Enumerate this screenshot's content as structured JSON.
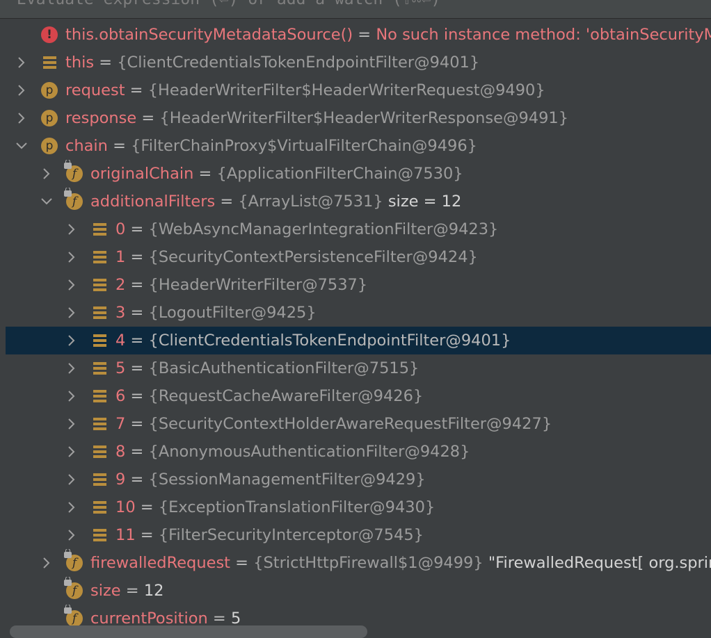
{
  "eval_bar": {
    "placeholder": "Evaluate expression (⏎) or add a watch (⇧⌘⏎)"
  },
  "rows": [
    {
      "name": "this.obtainSecurityMetadataSource()",
      "eq": " = ",
      "error": "No such instance method: 'obtainSecurityMetadataSource'"
    },
    {
      "name": "this",
      "eq": " = ",
      "value": "{ClientCredentialsTokenEndpointFilter@9401}"
    },
    {
      "name": "request",
      "eq": " = ",
      "value": "{HeaderWriterFilter$HeaderWriterRequest@9490}"
    },
    {
      "name": "response",
      "eq": " = ",
      "value": "{HeaderWriterFilter$HeaderWriterResponse@9491}"
    },
    {
      "name": "chain",
      "eq": " = ",
      "value": "{FilterChainProxy$VirtualFilterChain@9496}"
    },
    {
      "name": "originalChain",
      "eq": " = ",
      "value": "{ApplicationFilterChain@7530}"
    },
    {
      "name": "additionalFilters",
      "eq": " = ",
      "value": "{ArrayList@7531}",
      "extra": "  size = 12"
    },
    {
      "name": "0",
      "eq": " = ",
      "value": "{WebAsyncManagerIntegrationFilter@9423}"
    },
    {
      "name": "1",
      "eq": " = ",
      "value": "{SecurityContextPersistenceFilter@9424}"
    },
    {
      "name": "2",
      "eq": " = ",
      "value": "{HeaderWriterFilter@7537}"
    },
    {
      "name": "3",
      "eq": " = ",
      "value": "{LogoutFilter@9425}"
    },
    {
      "name": "4",
      "eq": " = ",
      "value": "{ClientCredentialsTokenEndpointFilter@9401}"
    },
    {
      "name": "5",
      "eq": " = ",
      "value": "{BasicAuthenticationFilter@7515}"
    },
    {
      "name": "6",
      "eq": " = ",
      "value": "{RequestCacheAwareFilter@9426}"
    },
    {
      "name": "7",
      "eq": " = ",
      "value": "{SecurityContextHolderAwareRequestFilter@9427}"
    },
    {
      "name": "8",
      "eq": " = ",
      "value": "{AnonymousAuthenticationFilter@9428}"
    },
    {
      "name": "9",
      "eq": " = ",
      "value": "{SessionManagementFilter@9429}"
    },
    {
      "name": "10",
      "eq": " = ",
      "value": "{ExceptionTranslationFilter@9430}"
    },
    {
      "name": "11",
      "eq": " = ",
      "value": "{FilterSecurityInterceptor@7545}"
    },
    {
      "name": "firewalledRequest",
      "eq": " = ",
      "value": "{StrictHttpFirewall$1@9499}",
      "extra": " \"FirewalledRequest[ org.springframework.security.web.header.HeaderWriterFilter"
    },
    {
      "name": "size",
      "eq": " = ",
      "extra": "12"
    },
    {
      "name": "currentPosition",
      "eq": " = ",
      "extra": "5"
    }
  ],
  "icons": {
    "error": "error-icon",
    "field": "field-icon",
    "parameter": "parameter-icon",
    "array": "array-element-icon",
    "expand": "chevron-right-icon",
    "collapse": "chevron-down-icon"
  },
  "colors": {
    "background": "#3c3f41",
    "selection": "#0d293e",
    "name": "#e8767b",
    "value": "#9c9c9c",
    "icon": "#b98e3d"
  }
}
